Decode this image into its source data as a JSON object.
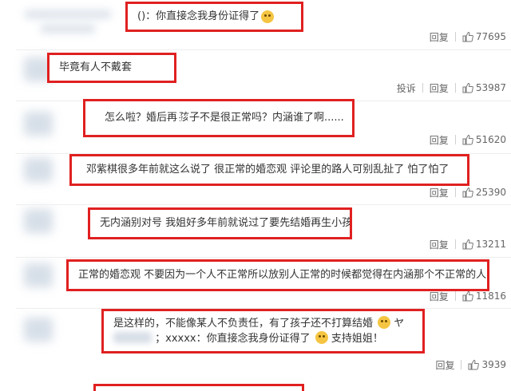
{
  "comments": [
    {
      "text": "()：你直接念我身份证得了",
      "emoji": "doge-emoji",
      "actions": {
        "reply": "回复",
        "likes": "77695"
      }
    },
    {
      "text": "毕竟有人不戴套",
      "actions": {
        "report": "投诉",
        "reply": "回复",
        "likes": "53987"
      }
    },
    {
      "text_a": "怎么啦？婚后再",
      "text_b": "孩子不是很正常吗？内涵谁了啊......",
      "actions": {
        "reply": "回复",
        "likes": "51620"
      }
    },
    {
      "text": "邓紫棋很多年前就这么说了    很正常的婚恋观 评论里的路人可别乱扯了 怕了怕了",
      "actions": {
        "reply": "回复",
        "likes": "25390"
      }
    },
    {
      "text": "无内涵别对号 我姐好多年前就说过了要先结婚再生小孩",
      "actions": {
        "reply": "回复",
        "likes": "13211"
      }
    },
    {
      "text": "正常的婚恋观 不要因为一个人不正常所以放别人正常的时候都觉得在内涵那个不正常的人",
      "actions": {
        "reply": "回复",
        "likes": "11816"
      }
    },
    {
      "line1": "是这样的，不能像某人不负责任，有了孩子还不打算结婚",
      "line1_tail": "ヤ",
      "line2_a": "；xxxxx：你直接念我身份证得了",
      "line2_b": "支持姐姐！",
      "actions": {
        "reply": "回复",
        "likes": "3939"
      }
    }
  ],
  "colors": {
    "highlight_border": "#e02020",
    "text": "#333333",
    "meta": "#666666"
  },
  "icons": {
    "like": "thumbs-up-icon",
    "emoji": "doge-emoji",
    "inline": "red-baby-icon"
  }
}
